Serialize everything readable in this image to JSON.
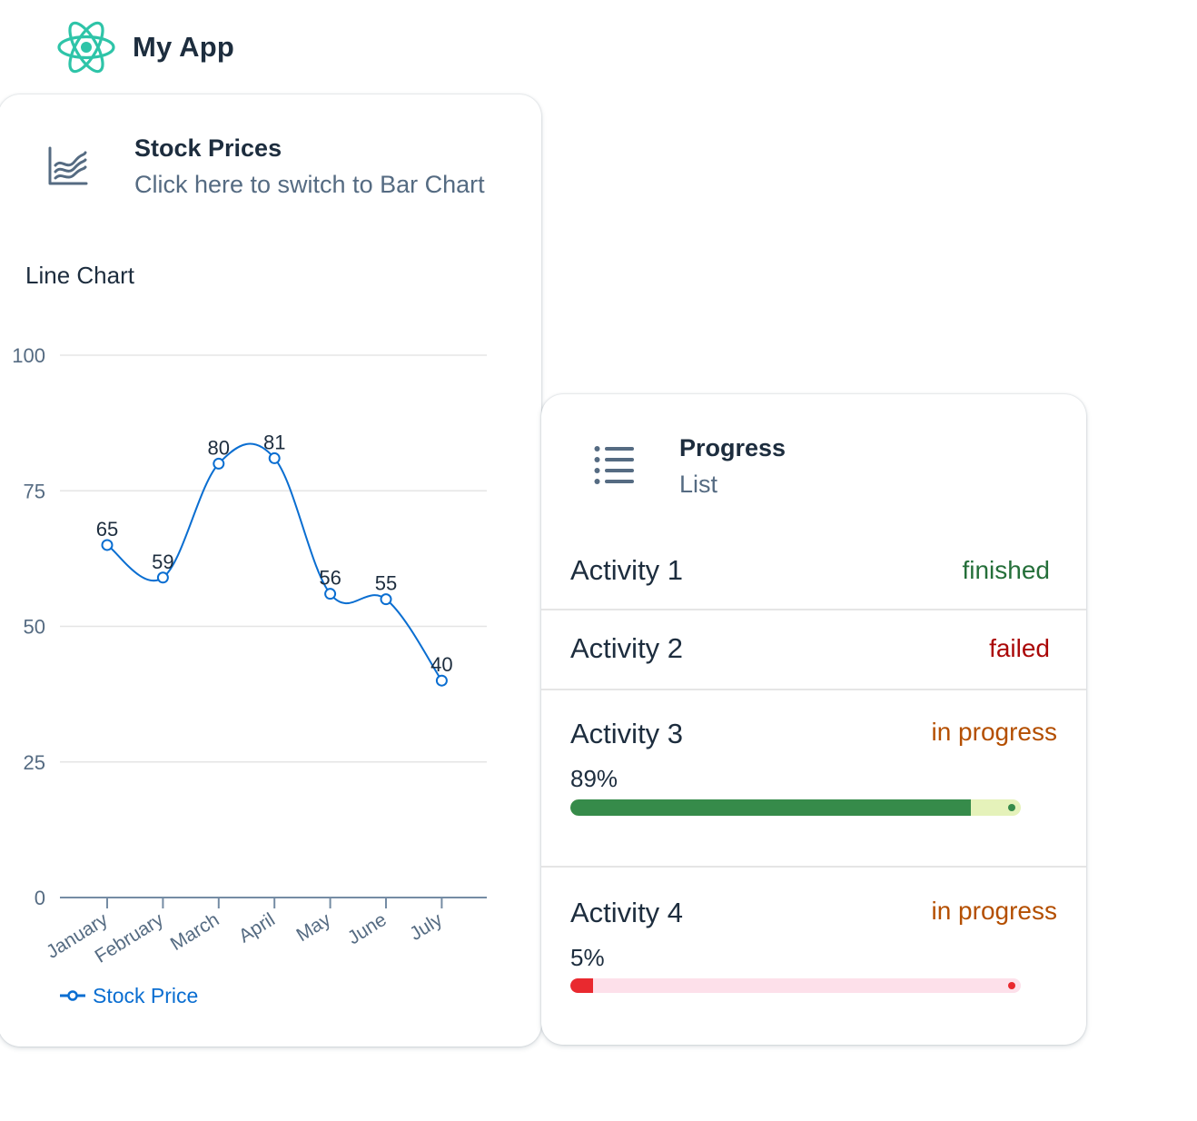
{
  "app": {
    "title": "My App",
    "logo_icon": "react-atom-icon",
    "logo_color": "#2ec4a8"
  },
  "stock_card": {
    "icon": "line-chart-icon",
    "title": "Stock Prices",
    "subtitle": "Click here to switch to Bar Chart",
    "chart_heading": "Line Chart"
  },
  "chart_data": {
    "type": "line",
    "title": "Line Chart",
    "categories": [
      "January",
      "February",
      "March",
      "April",
      "May",
      "June",
      "July"
    ],
    "series": [
      {
        "name": "Stock Price",
        "values": [
          65,
          59,
          80,
          81,
          56,
          55,
          40
        ],
        "color": "#0a6ed1"
      }
    ],
    "ylim": [
      0,
      100
    ],
    "yticks": [
      0,
      25,
      50,
      75,
      100
    ],
    "grid": true,
    "legend": "bottom-left",
    "data_labels": true
  },
  "progress_card": {
    "icon": "list-icon",
    "title": "Progress",
    "subtitle": "List",
    "items": [
      {
        "title": "Activity 1",
        "status": "finished",
        "status_color": "#256f3a"
      },
      {
        "title": "Activity 2",
        "status": "failed",
        "status_color": "#aa0808"
      },
      {
        "title": "Activity 3",
        "status": "in progress",
        "status_color": "#b44f00",
        "percent_label": "89%",
        "percent": 89,
        "bar_color": "#368b4a",
        "track_color": "#e5f2ba",
        "dot_color": "#368b4a"
      },
      {
        "title": "Activity 4",
        "status": "in progress",
        "status_color": "#b44f00",
        "percent_label": "5%",
        "percent": 5,
        "bar_color": "#e9292f",
        "track_color": "#fde0ea",
        "dot_color": "#e9292f"
      }
    ]
  }
}
